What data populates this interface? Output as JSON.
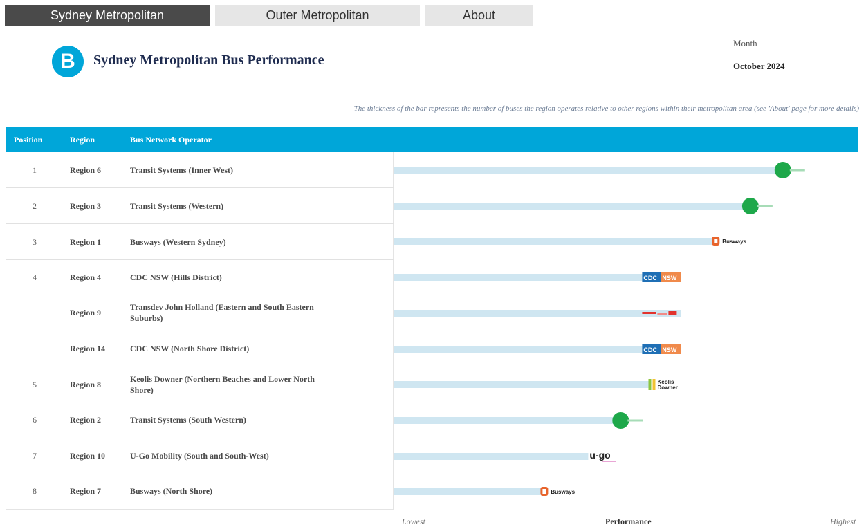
{
  "tabs": [
    {
      "label": "Sydney Metropolitan",
      "active": true
    },
    {
      "label": "Outer Metropolitan",
      "active": false
    },
    {
      "label": "About",
      "active": false
    }
  ],
  "header": {
    "logo_letter": "B",
    "title": "Sydney Metropolitan Bus Performance",
    "month_label": "Month",
    "month_value": "October 2024"
  },
  "note": "The thickness of the bar represents the number of buses the region operates relative to other regions within their metropolitan area (see 'About' page for more details)",
  "table": {
    "columns": [
      "Position",
      "Region",
      "Bus Network Operator"
    ],
    "rows": [
      {
        "position": "1",
        "region": "Region 6",
        "operator": "Transit Systems (Inner West)",
        "logo": "transit-systems-logo"
      },
      {
        "position": "2",
        "region": "Region 3",
        "operator": "Transit Systems (Western)",
        "logo": "transit-systems-logo"
      },
      {
        "position": "3",
        "region": "Region 1",
        "operator": "Busways (Western Sydney)",
        "logo": "busways-logo"
      },
      {
        "position": "4",
        "region": "Region 4",
        "operator": "CDC NSW (Hills District)",
        "logo": "cdc-nsw-logo"
      },
      {
        "position": "",
        "region": "Region 9",
        "operator": "Transdev John Holland (Eastern and South Eastern Suburbs)",
        "logo": "transdev-logo"
      },
      {
        "position": "",
        "region": "Region 14",
        "operator": "CDC NSW (North Shore District)",
        "logo": "cdc-nsw-logo"
      },
      {
        "position": "5",
        "region": "Region 8",
        "operator": "Keolis Downer (Northern Beaches and Lower North Shore)",
        "logo": "keolis-downer-logo"
      },
      {
        "position": "6",
        "region": "Region 2",
        "operator": "Transit Systems (South Western)",
        "logo": "transit-systems-logo"
      },
      {
        "position": "7",
        "region": "Region 10",
        "operator": "U-Go Mobility (South and South-West)",
        "logo": "u-go-logo"
      },
      {
        "position": "8",
        "region": "Region 7",
        "operator": "Busways (North Shore)",
        "logo": "busways-logo"
      }
    ]
  },
  "logo_text": {
    "busways": "Busways",
    "cdc": "CDC",
    "nsw": "NSW",
    "keolis": "Keolis",
    "downer": "Downer",
    "ugo": "u-go"
  },
  "chart_data": {
    "type": "bar",
    "orientation": "horizontal",
    "categories": [
      "Region 6",
      "Region 3",
      "Region 1",
      "Region 4",
      "Region 9",
      "Region 14",
      "Region 8",
      "Region 2",
      "Region 10",
      "Region 7"
    ],
    "values": [
      0.84,
      0.77,
      0.69,
      0.62,
      0.62,
      0.62,
      0.55,
      0.49,
      0.42,
      0.32
    ],
    "xlabel": "Performance",
    "x_min_label": "Lowest",
    "x_max_label": "Highest",
    "bar_color": "#cfe6f1"
  },
  "colors": {
    "accent": "#00a6d9",
    "tab_active": "#4a4a4a",
    "tab_inactive": "#e6e6e6",
    "title": "#1e2b4f",
    "transit_green": "#1ea84a",
    "busways_orange": "#e8642c",
    "cdc_blue": "#1f6fb5",
    "nsw_orange": "#f08a4b",
    "transdev_red": "#e2332e",
    "keolis_green": "#8cc63f"
  }
}
